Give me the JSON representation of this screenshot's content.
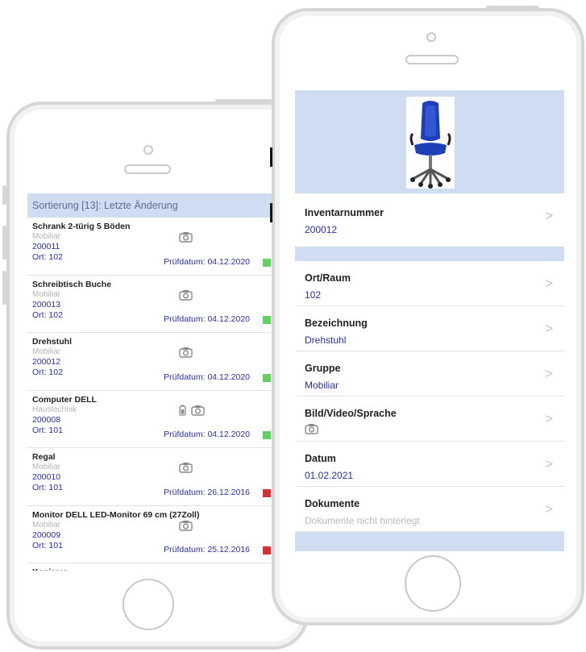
{
  "left_phone": {
    "sort_header": "Sortierung [13]: Letzte Änderung",
    "items": [
      {
        "title": "Schrank 2-türig 5 Böden",
        "group": "Mobiliar",
        "id": "200011",
        "ort": "Ort: 102",
        "pruefdatum": "Prüfdatum: 04.12.2020",
        "status_color": "#5ed45e",
        "icons": [
          "camera-icon"
        ]
      },
      {
        "title": "Schreibtisch Buche",
        "group": "Mobiliar",
        "id": "200013",
        "ort": "Ort: 102",
        "pruefdatum": "Prüfdatum: 04.12.2020",
        "status_color": "#5ed45e",
        "icons": [
          "camera-icon"
        ]
      },
      {
        "title": "Drehstuhl",
        "group": "Mobiliar",
        "id": "200012",
        "ort": "Ort: 102",
        "pruefdatum": "Prüfdatum: 04.12.2020",
        "status_color": "#5ed45e",
        "icons": [
          "camera-icon"
        ]
      },
      {
        "title": "Computer DELL",
        "group": "Haustechnik",
        "id": "200008",
        "ort": "Ort: 101",
        "pruefdatum": "Prüfdatum: 04.12.2020",
        "status_color": "#5ed45e",
        "icons": [
          "battery-icon",
          "camera-icon"
        ]
      },
      {
        "title": "Regal",
        "group": "Mobiliar",
        "id": "200010",
        "ort": "Ort: 101",
        "pruefdatum": "Prüfdatum: 26.12.2016",
        "status_color": "#d93030",
        "icons": [
          "camera-icon"
        ]
      },
      {
        "title": "Monitor DELL LED-Monitor 69 cm (27Zoll)",
        "group": "Mobiliar",
        "id": "200009",
        "ort": "Ort: 101",
        "pruefdatum": "Prüfdatum: 25.12.2016",
        "status_color": "#d93030",
        "icons": [
          "camera-icon"
        ]
      },
      {
        "title": "Kopierer",
        "group": "",
        "id": "",
        "ort": "",
        "pruefdatum": "",
        "status_color": "",
        "icons": []
      }
    ]
  },
  "right_phone": {
    "inventarnummer": {
      "label": "Inventarnummer",
      "value": "200012"
    },
    "fields": [
      {
        "label": "Ort/Raum",
        "value": "102",
        "muted": false,
        "icon": ""
      },
      {
        "label": "Bezeichnung",
        "value": "Drehstuhl",
        "muted": false,
        "icon": ""
      },
      {
        "label": "Gruppe",
        "value": "Mobiliar",
        "muted": false,
        "icon": ""
      },
      {
        "label": "Bild/Video/Sprache",
        "value": "",
        "muted": false,
        "icon": "camera-icon"
      },
      {
        "label": "Datum",
        "value": "01.02.2021",
        "muted": false,
        "icon": ""
      },
      {
        "label": "Dokumente",
        "value": "Dokumente nicht hinterlegt",
        "muted": true,
        "icon": ""
      }
    ]
  },
  "colors": {
    "header_band": "#cfdcf2",
    "link_blue": "#2b2fa6",
    "status_green": "#5ed45e",
    "status_red": "#d93030"
  },
  "chevron_glyph": ">"
}
